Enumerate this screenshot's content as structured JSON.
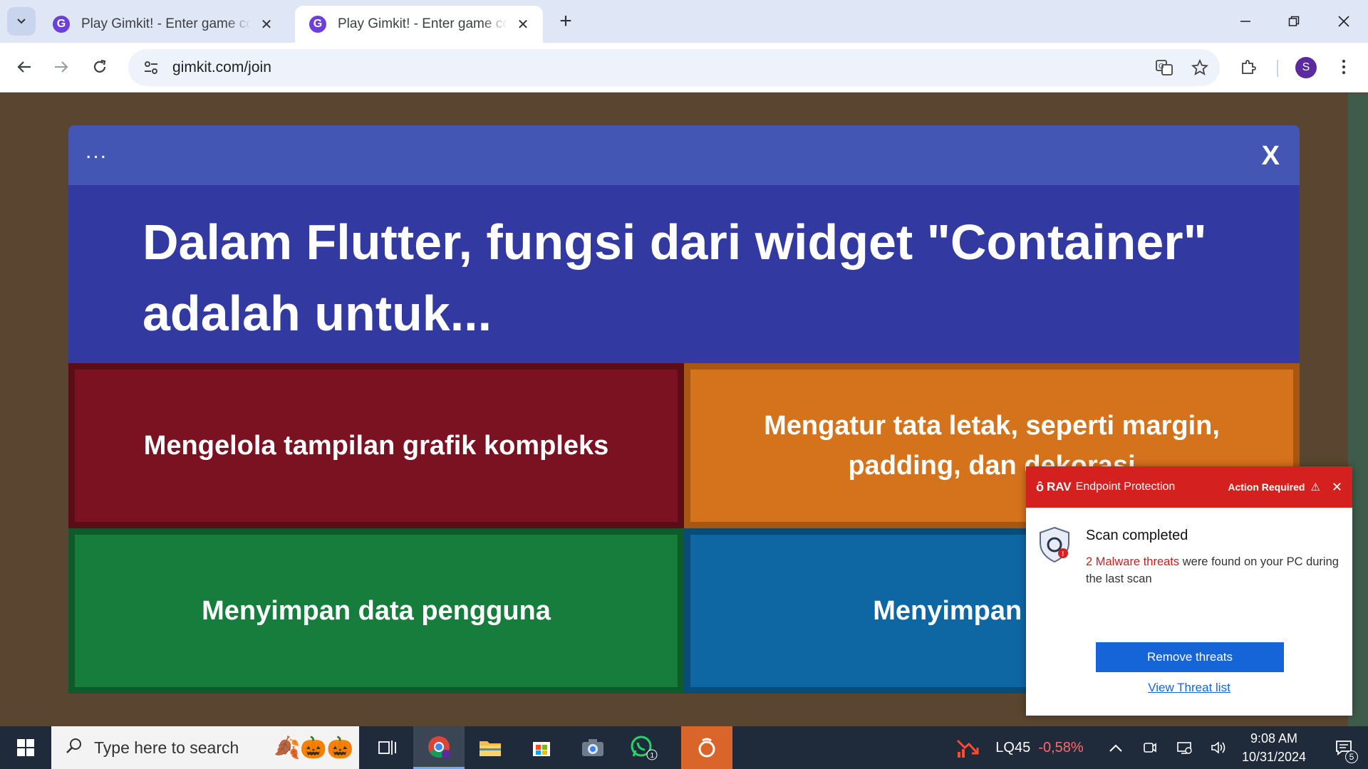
{
  "browser": {
    "tabs": [
      {
        "title": "Play Gimkit! - Enter game code",
        "favicon": "G",
        "active": false
      },
      {
        "title": "Play Gimkit! - Enter game code",
        "favicon": "G",
        "active": true
      }
    ],
    "new_tab_icon": "+",
    "url": "gimkit.com/join",
    "profile_initial": "S"
  },
  "gimkit": {
    "menu_dots": "...",
    "close_icon": "X",
    "question": "Dalam Flutter, fungsi dari widget \"Container\" adalah untuk...",
    "answers": [
      {
        "text": "Mengelola tampilan grafik kompleks",
        "color": "#7a1222"
      },
      {
        "text": "Mengatur tata letak, seperti margin, padding, dan dekorasi",
        "color": "#d4731b"
      },
      {
        "text": "Menyimpan data pengguna",
        "color": "#177d3d"
      },
      {
        "text": "Menyimpan konfig",
        "color": "#0e67a3"
      }
    ]
  },
  "rav": {
    "logo": "ô",
    "brand": "RAV",
    "product": "Endpoint Protection",
    "action": "Action Required",
    "warn_icon": "⚠",
    "close": "✕",
    "title": "Scan completed",
    "threat_text": "2 Malware threats",
    "message_rest": " were found on your PC during the last scan",
    "button": "Remove threats",
    "link": "View Threat list",
    "accent": "#d52020",
    "button_color": "#1565d8"
  },
  "taskbar": {
    "search_placeholder": "Type here to search",
    "stock_name": "LQ45",
    "stock_change": "-0,58%",
    "time": "9:08 AM",
    "date": "10/31/2024",
    "notification_count": "5",
    "whatsapp_badge": "1"
  }
}
